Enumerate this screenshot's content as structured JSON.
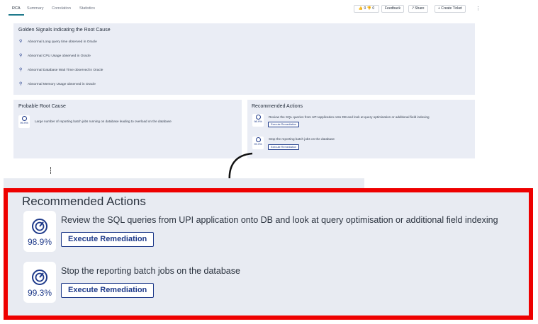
{
  "tabs": [
    "RCA",
    "Summary",
    "Correlation",
    "Statistics"
  ],
  "votes": {
    "up": "0",
    "down": "0"
  },
  "toolbar": {
    "feedback_label": "Feedback",
    "share_label": "Share",
    "create_ticket_label": "+ Create Ticket"
  },
  "golden_signals": {
    "title": "Golden Signals indicating the Root Cause",
    "items": [
      "Abnormal Long query time observed in Oracle",
      "Abnormal CPU Usage observed in Oracle",
      "Abnormal Database Wait Time observed in Oracle",
      "Abnormal Memory Usage observed in Oracle"
    ]
  },
  "probable_root_cause": {
    "title": "Probable Root Cause",
    "confidence": "99.9%",
    "text": "Large number of reporting batch jobs running on database leading to overload on the database"
  },
  "recommended_actions": {
    "title": "Recommended Actions",
    "actions": [
      {
        "confidence": "98.9%",
        "text": "Review the SQL queries from UPI application onto DB and look at query optimisation or additional field indexing",
        "button": "Execute Remediation"
      },
      {
        "confidence": "99.3%",
        "text": "Stop the reporting batch jobs on the database",
        "button": "Execute Remediation"
      }
    ]
  },
  "colors": {
    "accent": "#1e3a8a",
    "panel": "#eaedf5",
    "highlight": "#ee0000"
  }
}
